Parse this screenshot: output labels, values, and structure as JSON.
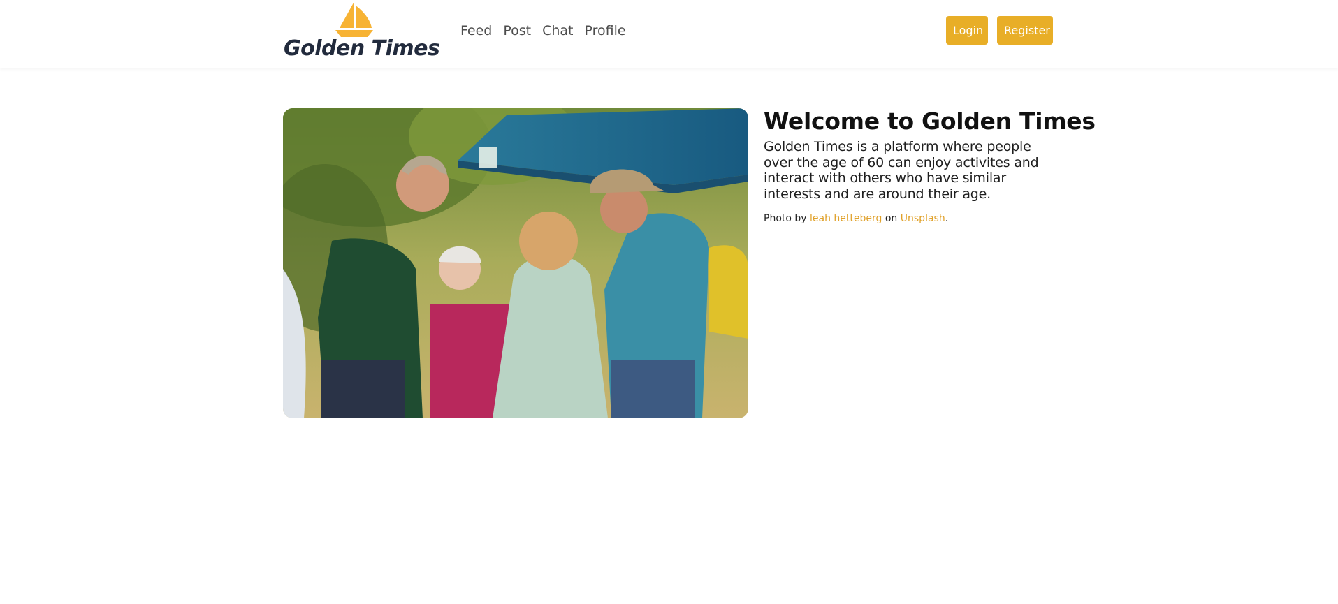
{
  "brand": {
    "name": "Golden Times",
    "logo_icon": "sailboat-icon",
    "logo_color": "#f7b334",
    "text_color": "#222b3d"
  },
  "nav": {
    "items": [
      {
        "label": "Feed"
      },
      {
        "label": "Post"
      },
      {
        "label": "Chat"
      },
      {
        "label": "Profile"
      }
    ]
  },
  "auth": {
    "login_label": "Login",
    "register_label": "Register",
    "button_color": "#e8ae27"
  },
  "hero": {
    "title": "Welcome to Golden Times",
    "description": "Golden Times is a platform where people over the age of 60 can enjoy activites and interact with others who have similar interests and are around their age.",
    "credit_prefix": "Photo by",
    "credit_author": "leah hetteberg",
    "credit_middle": "on",
    "credit_source": "Unsplash",
    "credit_suffix": ".",
    "link_color": "#e0a12a"
  }
}
